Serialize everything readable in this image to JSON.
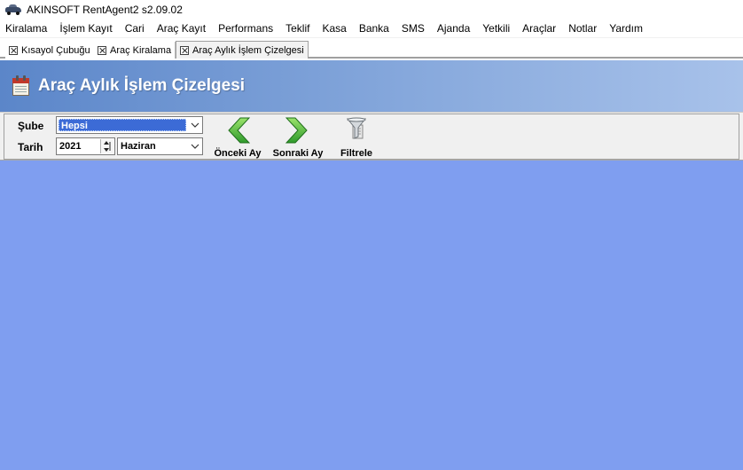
{
  "window": {
    "title": "AKINSOFT RentAgent2 s2.09.02",
    "icon": "car-icon"
  },
  "menu": [
    {
      "label": "Kiralama"
    },
    {
      "label": "İşlem Kayıt"
    },
    {
      "label": "Cari"
    },
    {
      "label": "Araç Kayıt"
    },
    {
      "label": "Performans"
    },
    {
      "label": "Teklif"
    },
    {
      "label": "Kasa"
    },
    {
      "label": "Banka"
    },
    {
      "label": "SMS"
    },
    {
      "label": "Ajanda"
    },
    {
      "label": "Yetkili"
    },
    {
      "label": "Araçlar"
    },
    {
      "label": "Notlar"
    },
    {
      "label": "Yardım"
    }
  ],
  "tabs": [
    {
      "label": "Kısayol Çubuğu",
      "active": false
    },
    {
      "label": "Araç Kiralama",
      "active": false
    },
    {
      "label": "Araç Aylık İşlem Çizelgesi",
      "active": true
    }
  ],
  "header": {
    "title": "Araç Aylık İşlem Çizelgesi",
    "icon": "calendar-icon"
  },
  "filters": {
    "sube_label": "Şube",
    "sube_value": "Hepsi",
    "tarih_label": "Tarih",
    "year_value": "2021",
    "month_value": "Haziran"
  },
  "toolbar": {
    "prev_label": "Önceki Ay",
    "next_label": "Sonraki Ay",
    "filter_label": "Filtrele"
  },
  "colors": {
    "header_gradient_start": "#5b86c9",
    "header_gradient_end": "#a8c2ea",
    "content_background": "#7f9ef0",
    "selection_blue": "#3c6bd6",
    "arrow_green": "#3aa935"
  }
}
